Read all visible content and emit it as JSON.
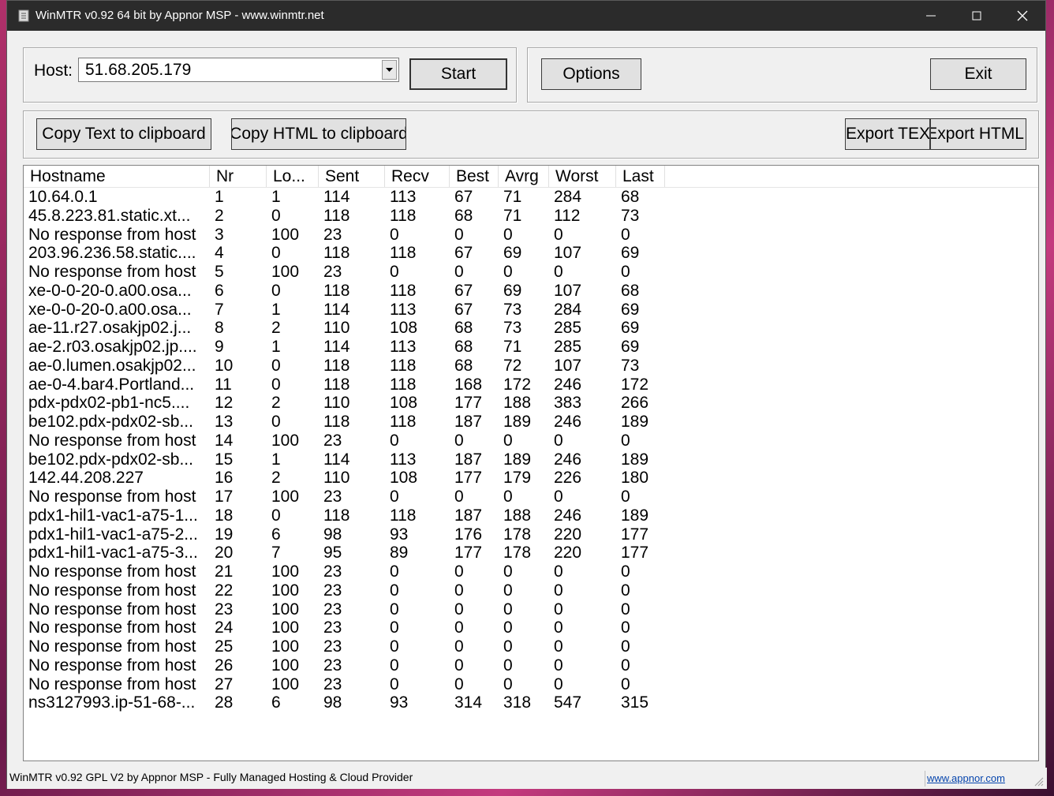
{
  "window": {
    "title": "WinMTR v0.92 64 bit by Appnor MSP - www.winmtr.net",
    "minimize_icon": "minimize-icon",
    "maximize_icon": "maximize-icon",
    "close_icon": "close-icon"
  },
  "host": {
    "label": "Host:",
    "value": "51.68.205.179"
  },
  "buttons": {
    "start": "Start",
    "options": "Options",
    "exit": "Exit",
    "copy_text": "Copy Text to clipboard",
    "copy_html": "Copy HTML to clipboard",
    "export_text": "Export TEXT",
    "export_html": "Export HTML"
  },
  "columns": [
    "Hostname",
    "Nr",
    "Lo...",
    "Sent",
    "Recv",
    "Best",
    "Avrg",
    "Worst",
    "Last"
  ],
  "rows": [
    [
      "10.64.0.1",
      "1",
      "1",
      "114",
      "113",
      "67",
      "71",
      "284",
      "68"
    ],
    [
      "45.8.223.81.static.xt...",
      "2",
      "0",
      "118",
      "118",
      "68",
      "71",
      "112",
      "73"
    ],
    [
      "No response from host",
      "3",
      "100",
      "23",
      "0",
      "0",
      "0",
      "0",
      "0"
    ],
    [
      "203.96.236.58.static....",
      "4",
      "0",
      "118",
      "118",
      "67",
      "69",
      "107",
      "69"
    ],
    [
      "No response from host",
      "5",
      "100",
      "23",
      "0",
      "0",
      "0",
      "0",
      "0"
    ],
    [
      "xe-0-0-20-0.a00.osa...",
      "6",
      "0",
      "118",
      "118",
      "67",
      "69",
      "107",
      "68"
    ],
    [
      "xe-0-0-20-0.a00.osa...",
      "7",
      "1",
      "114",
      "113",
      "67",
      "73",
      "284",
      "69"
    ],
    [
      "ae-11.r27.osakjp02.j...",
      "8",
      "2",
      "110",
      "108",
      "68",
      "73",
      "285",
      "69"
    ],
    [
      "ae-2.r03.osakjp02.jp....",
      "9",
      "1",
      "114",
      "113",
      "68",
      "71",
      "285",
      "69"
    ],
    [
      "ae-0.lumen.osakjp02...",
      "10",
      "0",
      "118",
      "118",
      "68",
      "72",
      "107",
      "73"
    ],
    [
      "ae-0-4.bar4.Portland...",
      "11",
      "0",
      "118",
      "118",
      "168",
      "172",
      "246",
      "172"
    ],
    [
      "pdx-pdx02-pb1-nc5....",
      "12",
      "2",
      "110",
      "108",
      "177",
      "188",
      "383",
      "266"
    ],
    [
      "be102.pdx-pdx02-sb...",
      "13",
      "0",
      "118",
      "118",
      "187",
      "189",
      "246",
      "189"
    ],
    [
      "No response from host",
      "14",
      "100",
      "23",
      "0",
      "0",
      "0",
      "0",
      "0"
    ],
    [
      "be102.pdx-pdx02-sb...",
      "15",
      "1",
      "114",
      "113",
      "187",
      "189",
      "246",
      "189"
    ],
    [
      "142.44.208.227",
      "16",
      "2",
      "110",
      "108",
      "177",
      "179",
      "226",
      "180"
    ],
    [
      "No response from host",
      "17",
      "100",
      "23",
      "0",
      "0",
      "0",
      "0",
      "0"
    ],
    [
      "pdx1-hil1-vac1-a75-1...",
      "18",
      "0",
      "118",
      "118",
      "187",
      "188",
      "246",
      "189"
    ],
    [
      "pdx1-hil1-vac1-a75-2...",
      "19",
      "6",
      "98",
      "93",
      "176",
      "178",
      "220",
      "177"
    ],
    [
      "pdx1-hil1-vac1-a75-3...",
      "20",
      "7",
      "95",
      "89",
      "177",
      "178",
      "220",
      "177"
    ],
    [
      "No response from host",
      "21",
      "100",
      "23",
      "0",
      "0",
      "0",
      "0",
      "0"
    ],
    [
      "No response from host",
      "22",
      "100",
      "23",
      "0",
      "0",
      "0",
      "0",
      "0"
    ],
    [
      "No response from host",
      "23",
      "100",
      "23",
      "0",
      "0",
      "0",
      "0",
      "0"
    ],
    [
      "No response from host",
      "24",
      "100",
      "23",
      "0",
      "0",
      "0",
      "0",
      "0"
    ],
    [
      "No response from host",
      "25",
      "100",
      "23",
      "0",
      "0",
      "0",
      "0",
      "0"
    ],
    [
      "No response from host",
      "26",
      "100",
      "23",
      "0",
      "0",
      "0",
      "0",
      "0"
    ],
    [
      "No response from host",
      "27",
      "100",
      "23",
      "0",
      "0",
      "0",
      "0",
      "0"
    ],
    [
      "ns3127993.ip-51-68-...",
      "28",
      "6",
      "98",
      "93",
      "314",
      "318",
      "547",
      "315"
    ]
  ],
  "status": {
    "text": "WinMTR v0.92 GPL V2 by Appnor MSP - Fully Managed Hosting & Cloud Provider",
    "link": "www.appnor.com"
  }
}
